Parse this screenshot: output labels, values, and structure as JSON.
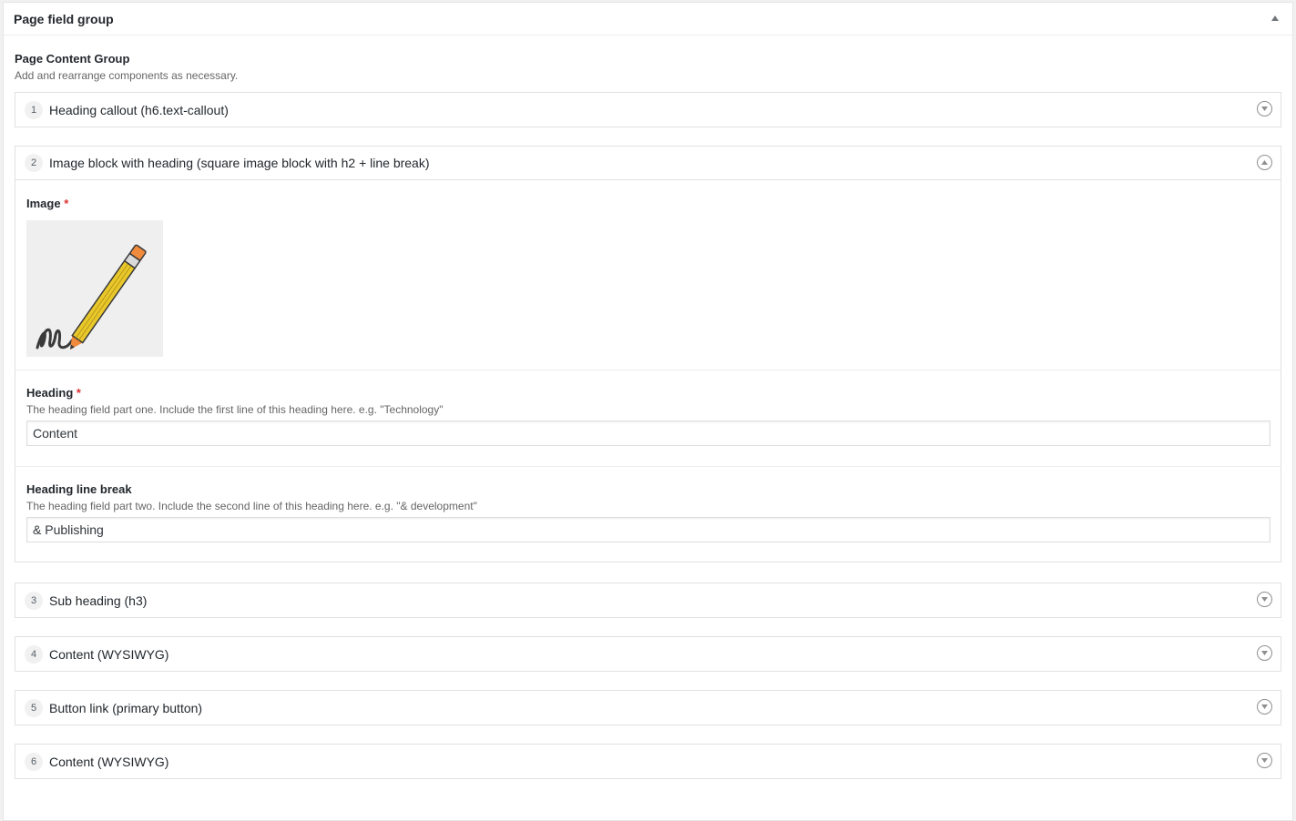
{
  "postbox": {
    "title": "Page field group"
  },
  "group": {
    "label": "Page Content Group",
    "description": "Add and rearrange components as necessary."
  },
  "layouts": [
    {
      "order": "1",
      "label": "Heading callout (h6.text-callout)"
    },
    {
      "order": "2",
      "label": "Image block with heading (square image block with h2 + line break)"
    },
    {
      "order": "3",
      "label": "Sub heading (h3)"
    },
    {
      "order": "4",
      "label": "Content (WYSIWYG)"
    },
    {
      "order": "5",
      "label": "Button link (primary button)"
    },
    {
      "order": "6",
      "label": "Content (WYSIWYG)"
    }
  ],
  "fields": {
    "image": {
      "label": "Image",
      "required_mark": "*"
    },
    "heading": {
      "label": "Heading",
      "required_mark": "*",
      "description": "The heading field part one. Include the first line of this heading here. e.g. \"Technology\"",
      "value": "Content"
    },
    "heading_break": {
      "label": "Heading line break",
      "description": "The heading field part two. Include the second line of this heading here. e.g. \"& development\"",
      "value": "& Publishing"
    }
  },
  "icons": {
    "postbox_toggle": "triangle-up-icon",
    "collapsed": "chevron-down-circle-icon",
    "expanded": "chevron-up-circle-icon",
    "image": "pencil-icon"
  },
  "colors": {
    "required": "#dc3232",
    "pencil_body": "#e8c82a",
    "pencil_tip": "#f08a3c"
  }
}
